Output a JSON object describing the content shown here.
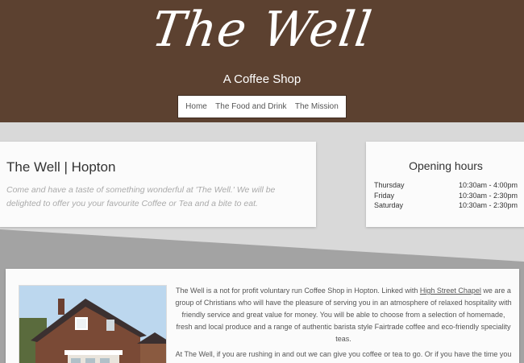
{
  "header": {
    "logo_text": "The Well",
    "tagline": "A Coffee Shop",
    "nav": [
      "Home",
      "The Food and Drink",
      "The Mission"
    ]
  },
  "intro": {
    "title": "The Well | Hopton",
    "text": "Come and have a taste of something wonderful at 'The Well.' We will be delighted to offer you your favourite Coffee or Tea and a bite to eat."
  },
  "hours": {
    "title": "Opening hours",
    "rows": [
      {
        "day": "Thursday",
        "time": "10:30am - 4:00pm"
      },
      {
        "day": "Friday",
        "time": "10:30am - 2:30pm"
      },
      {
        "day": "Saturday",
        "time": "10:30am - 2:30pm"
      }
    ]
  },
  "about": {
    "p1_before": "The Well is a not for profit voluntary run Coffee Shop in Hopton. Linked with ",
    "p1_link": "High Street Chapel",
    "p1_after": " we are a group of Christians who will have the pleasure of serving you in an atmosphere of relaxed hospitality with friendly service and great value for money. You will be able to choose from a selection of homemade, fresh and local produce and a range of authentic barista style Fairtrade coffee and eco-friendly speciality teas.",
    "p2": "At The Well, if you are rushing in and out we can give you coffee or tea to go. Or if you have the time you can choose to sit quietly for as long as you like or chat with a work colleague. You will find us situated"
  },
  "colors": {
    "header_bg": "#5c4130",
    "band_bg": "#d9d9d9",
    "slant_bg": "#a3a3a3"
  }
}
